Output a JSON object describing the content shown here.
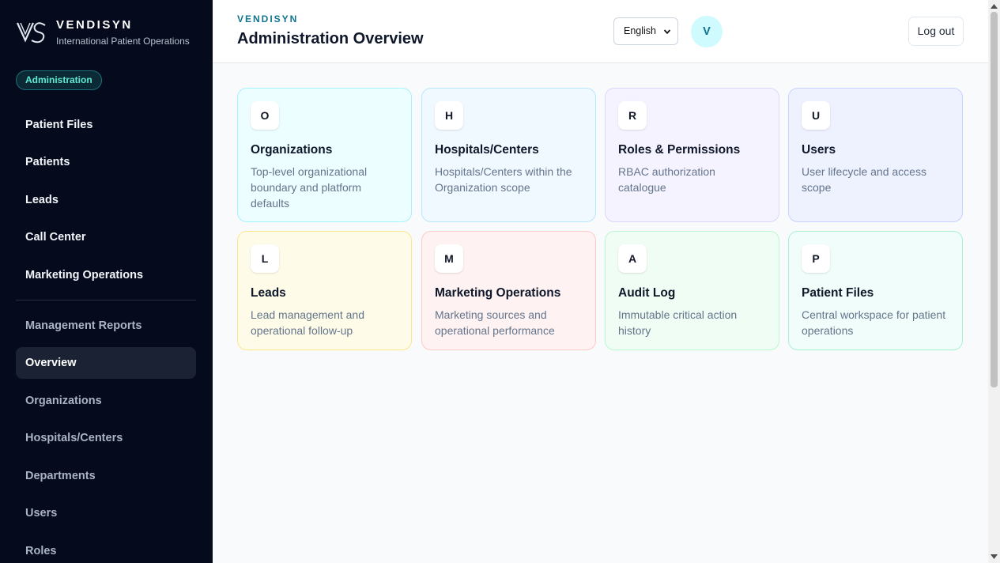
{
  "sidebar": {
    "brand_name": "VENDISYN",
    "brand_sub": "International Patient Operations",
    "role_badge": "Administration",
    "primary_items": [
      {
        "label": "Patient Files"
      },
      {
        "label": "Patients"
      },
      {
        "label": "Leads"
      },
      {
        "label": "Call Center"
      },
      {
        "label": "Marketing Operations"
      }
    ],
    "admin_items": [
      {
        "label": "Management Reports"
      },
      {
        "label": "Overview"
      },
      {
        "label": "Organizations"
      },
      {
        "label": "Hospitals/Centers"
      },
      {
        "label": "Departments"
      },
      {
        "label": "Users"
      },
      {
        "label": "Roles"
      }
    ],
    "active_item": "Overview"
  },
  "header": {
    "eyebrow": "VENDISYN",
    "title": "Administration Overview",
    "language": "English",
    "avatar_initial": "V",
    "logout_label": "Log out"
  },
  "cards": [
    {
      "letter": "O",
      "title": "Organizations",
      "description": "Top-level organizational boundary and platform defaults",
      "bg": "#ecfeff",
      "border": "#a5f3fc"
    },
    {
      "letter": "H",
      "title": "Hospitals/Centers",
      "description": "Hospitals/Centers within the Organization scope",
      "bg": "#f0f9ff",
      "border": "#bae6fd"
    },
    {
      "letter": "R",
      "title": "Roles & Permissions",
      "description": "RBAC authorization catalogue",
      "bg": "#f5f3ff",
      "border": "#ddd6fe"
    },
    {
      "letter": "U",
      "title": "Users",
      "description": "User lifecycle and access scope",
      "bg": "#eef2ff",
      "border": "#c7d2fe"
    },
    {
      "letter": "L",
      "title": "Leads",
      "description": "Lead management and operational follow-up",
      "bg": "#fefce8",
      "border": "#fde68a"
    },
    {
      "letter": "M",
      "title": "Marketing Operations",
      "description": "Marketing sources and operational performance",
      "bg": "#fef2f2",
      "border": "#fecaca"
    },
    {
      "letter": "A",
      "title": "Audit Log",
      "description": "Immutable critical action history",
      "bg": "#f0fdf4",
      "border": "#bbf7d0"
    },
    {
      "letter": "P",
      "title": "Patient Files",
      "description": "Central workspace for patient operations",
      "bg": "#f0fdfa",
      "border": "#a7f3d0"
    }
  ],
  "icons": {
    "logo": "vs-logo-icon",
    "select": "chevron-down-icon",
    "scroll_up": "scroll-up-arrow-icon",
    "scroll_down": "scroll-down-arrow-icon"
  },
  "colors": {
    "sidebar_bg": "#050b1c",
    "accent": "#0e7490",
    "badge_text": "#5eead4"
  }
}
